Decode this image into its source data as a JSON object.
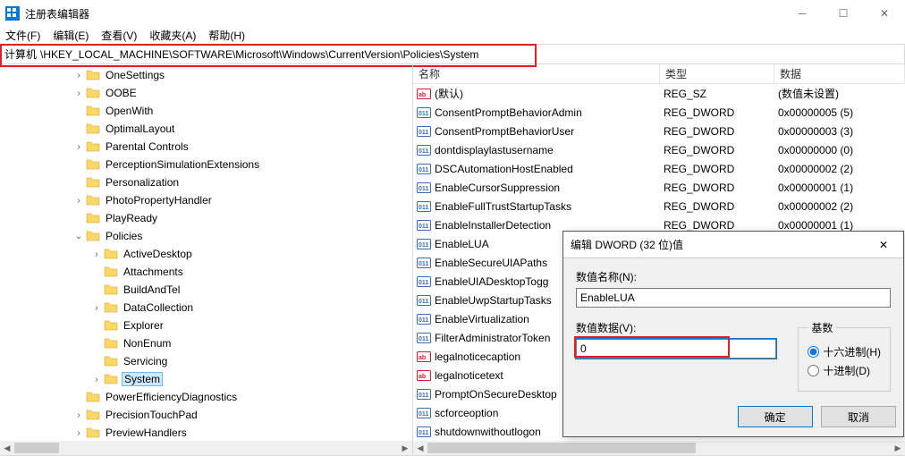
{
  "window": {
    "title": "注册表编辑器"
  },
  "menu": {
    "file": "文件(F)",
    "edit": "编辑(E)",
    "view": "查看(V)",
    "fav": "收藏夹(A)",
    "help": "帮助(H)"
  },
  "address": {
    "label": "计算机",
    "path": "\\HKEY_LOCAL_MACHINE\\SOFTWARE\\Microsoft\\Windows\\CurrentVersion\\Policies\\System"
  },
  "tree": [
    {
      "indent": 80,
      "chev": ">",
      "label": "OneSettings"
    },
    {
      "indent": 80,
      "chev": ">",
      "label": "OOBE"
    },
    {
      "indent": 80,
      "chev": "",
      "label": "OpenWith"
    },
    {
      "indent": 80,
      "chev": "",
      "label": "OptimalLayout"
    },
    {
      "indent": 80,
      "chev": ">",
      "label": "Parental Controls"
    },
    {
      "indent": 80,
      "chev": "",
      "label": "PerceptionSimulationExtensions"
    },
    {
      "indent": 80,
      "chev": "",
      "label": "Personalization"
    },
    {
      "indent": 80,
      "chev": ">",
      "label": "PhotoPropertyHandler"
    },
    {
      "indent": 80,
      "chev": "",
      "label": "PlayReady"
    },
    {
      "indent": 80,
      "chev": "v",
      "label": "Policies"
    },
    {
      "indent": 100,
      "chev": ">",
      "label": "ActiveDesktop"
    },
    {
      "indent": 100,
      "chev": "",
      "label": "Attachments"
    },
    {
      "indent": 100,
      "chev": "",
      "label": "BuildAndTel"
    },
    {
      "indent": 100,
      "chev": ">",
      "label": "DataCollection"
    },
    {
      "indent": 100,
      "chev": "",
      "label": "Explorer"
    },
    {
      "indent": 100,
      "chev": "",
      "label": "NonEnum"
    },
    {
      "indent": 100,
      "chev": "",
      "label": "Servicing"
    },
    {
      "indent": 100,
      "chev": ">",
      "label": "System",
      "selected": true
    },
    {
      "indent": 80,
      "chev": "",
      "label": "PowerEfficiencyDiagnostics"
    },
    {
      "indent": 80,
      "chev": ">",
      "label": "PrecisionTouchPad"
    },
    {
      "indent": 80,
      "chev": ">",
      "label": "PreviewHandlers"
    }
  ],
  "columns": {
    "name": "名称",
    "type": "类型",
    "data": "数据"
  },
  "values": [
    {
      "icon": "str",
      "name": "(默认)",
      "type": "REG_SZ",
      "data": "(数值未设置)"
    },
    {
      "icon": "bin",
      "name": "ConsentPromptBehaviorAdmin",
      "type": "REG_DWORD",
      "data": "0x00000005 (5)"
    },
    {
      "icon": "bin",
      "name": "ConsentPromptBehaviorUser",
      "type": "REG_DWORD",
      "data": "0x00000003 (3)"
    },
    {
      "icon": "bin",
      "name": "dontdisplaylastusername",
      "type": "REG_DWORD",
      "data": "0x00000000 (0)"
    },
    {
      "icon": "bin",
      "name": "DSCAutomationHostEnabled",
      "type": "REG_DWORD",
      "data": "0x00000002 (2)"
    },
    {
      "icon": "bin",
      "name": "EnableCursorSuppression",
      "type": "REG_DWORD",
      "data": "0x00000001 (1)"
    },
    {
      "icon": "bin",
      "name": "EnableFullTrustStartupTasks",
      "type": "REG_DWORD",
      "data": "0x00000002 (2)"
    },
    {
      "icon": "bin",
      "name": "EnableInstallerDetection",
      "type": "REG_DWORD",
      "data": "0x00000001 (1)"
    },
    {
      "icon": "bin",
      "name": "EnableLUA",
      "type": "",
      "data": ""
    },
    {
      "icon": "bin",
      "name": "EnableSecureUIAPaths",
      "type": "",
      "data": ""
    },
    {
      "icon": "bin",
      "name": "EnableUIADesktopTogg",
      "type": "",
      "data": ""
    },
    {
      "icon": "bin",
      "name": "EnableUwpStartupTasks",
      "type": "",
      "data": ""
    },
    {
      "icon": "bin",
      "name": "EnableVirtualization",
      "type": "",
      "data": ""
    },
    {
      "icon": "bin",
      "name": "FilterAdministratorToken",
      "type": "",
      "data": ""
    },
    {
      "icon": "str",
      "name": "legalnoticecaption",
      "type": "",
      "data": ""
    },
    {
      "icon": "str",
      "name": "legalnoticetext",
      "type": "",
      "data": ""
    },
    {
      "icon": "bin",
      "name": "PromptOnSecureDesktop",
      "type": "",
      "data": ""
    },
    {
      "icon": "bin",
      "name": "scforceoption",
      "type": "",
      "data": ""
    },
    {
      "icon": "bin",
      "name": "shutdownwithoutlogon",
      "type": "",
      "data": ""
    }
  ],
  "dialog": {
    "title": "编辑 DWORD (32 位)值",
    "name_label": "数值名称(N):",
    "name_value": "EnableLUA",
    "data_label": "数值数据(V):",
    "data_value": "0",
    "radix_label": "基数",
    "hex_label": "十六进制(H)",
    "dec_label": "十进制(D)",
    "ok": "确定",
    "cancel": "取消"
  }
}
